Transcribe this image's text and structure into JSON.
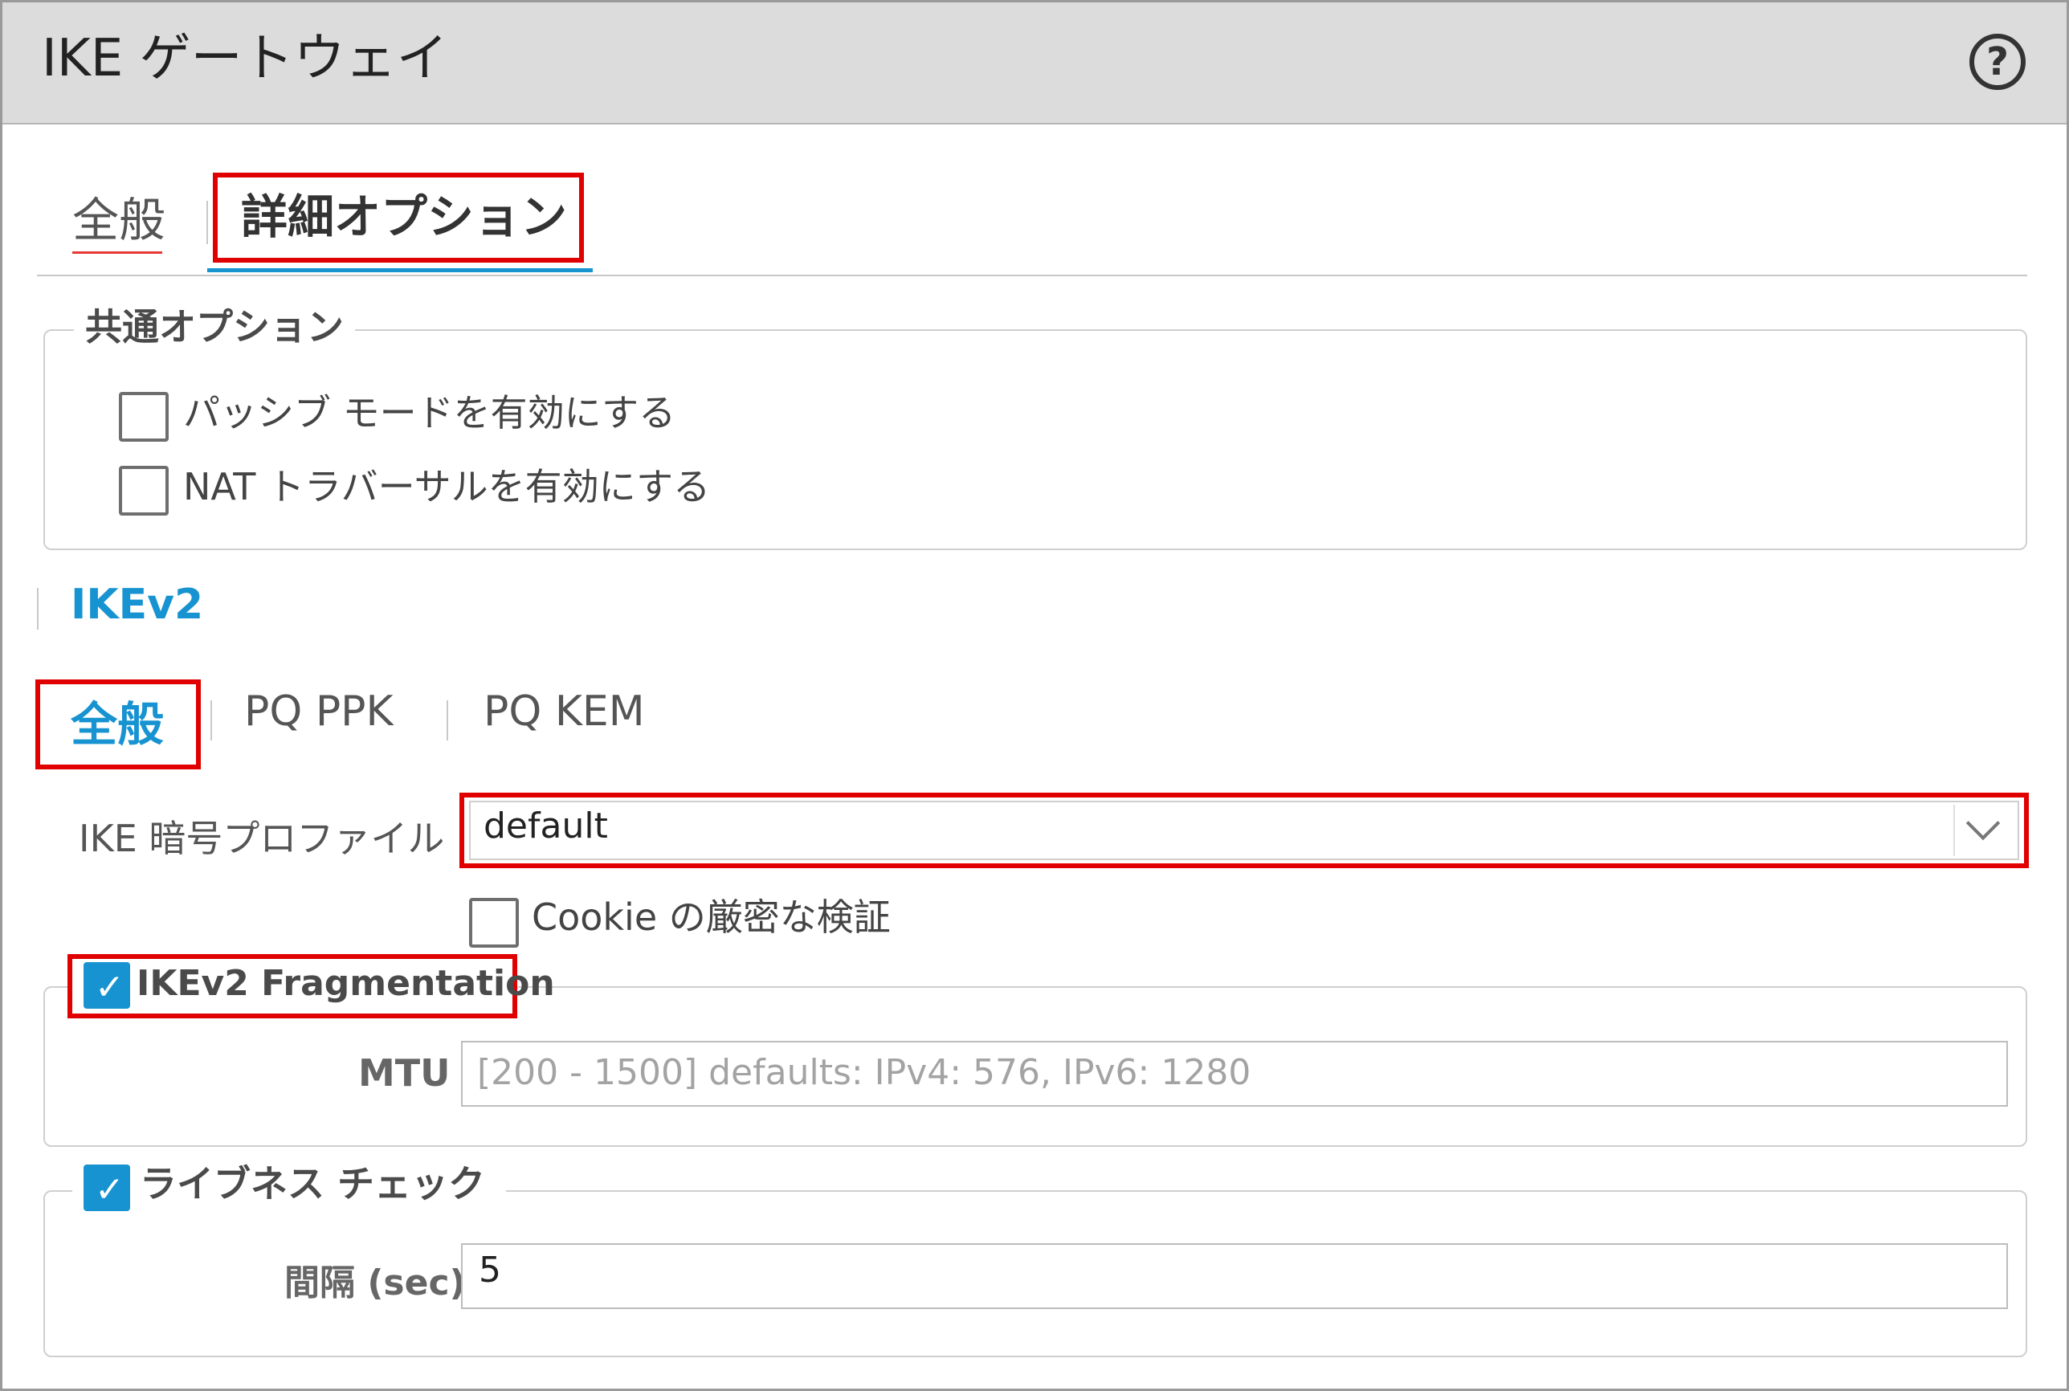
{
  "dialog": {
    "title": "IKE ゲートウェイ",
    "help_icon": "?"
  },
  "top_tabs": [
    {
      "label": "全般"
    },
    {
      "label": "詳細オプション"
    }
  ],
  "common_options": {
    "legend": "共通オプション",
    "passive_mode": {
      "label": "パッシブ モードを有効にする",
      "checked": false
    },
    "nat_traversal": {
      "label": "NAT トラバーサルを有効にする",
      "checked": false
    }
  },
  "ikev2": {
    "heading": "IKEv2",
    "sub_tabs": [
      {
        "label": "全般"
      },
      {
        "label": "PQ PPK"
      },
      {
        "label": "PQ KEM"
      }
    ],
    "crypto_profile": {
      "label": "IKE 暗号プロファイル",
      "value": "default"
    },
    "strict_cookie": {
      "label": "Cookie の厳密な検証",
      "checked": false
    },
    "fragmentation": {
      "label": "IKEv2 Fragmentation",
      "checked": true,
      "mtu_label": "MTU",
      "mtu_placeholder": "[200 - 1500] defaults: IPv4: 576, IPv6: 1280"
    },
    "liveness": {
      "label": "ライブネス チェック",
      "checked": true,
      "interval_label": "間隔 (sec)",
      "interval_value": "5"
    }
  },
  "colors": {
    "accent": "#1793d1",
    "highlight_box": "#e00000",
    "tab_underline_red": "#e53935"
  }
}
